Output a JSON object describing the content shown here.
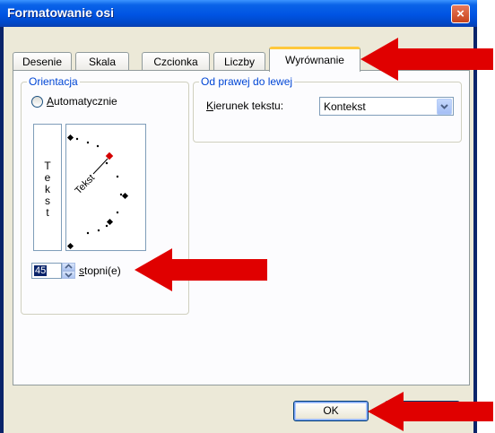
{
  "window": {
    "title": "Formatowanie osi",
    "close_label": "×"
  },
  "tabs": [
    {
      "label": "Desenie"
    },
    {
      "label": "Skala"
    },
    {
      "label": "Czcionka"
    },
    {
      "label": "Liczby"
    },
    {
      "label": "Wyrównanie",
      "active": true
    }
  ],
  "orientation": {
    "group_label": "Orientacja",
    "auto_label_u": "A",
    "auto_label_rest": "utomatycznie",
    "vertical_text": [
      "T",
      "e",
      "k",
      "s",
      "t"
    ],
    "dial_text": "Tekst",
    "degrees_value": "45",
    "degrees_label_u": "s",
    "degrees_label_rest": "topni(e)"
  },
  "rtl": {
    "group_label": "Od prawej do lewej",
    "direction_label_u": "K",
    "direction_label_rest": "ierunek tekstu:",
    "direction_value": "Kontekst"
  },
  "buttons": {
    "ok_label": "OK"
  },
  "colors": {
    "annotation_arrow": "#e00000",
    "title_bar": "#0054e3",
    "active_tab_highlight": "#ffc83c"
  }
}
